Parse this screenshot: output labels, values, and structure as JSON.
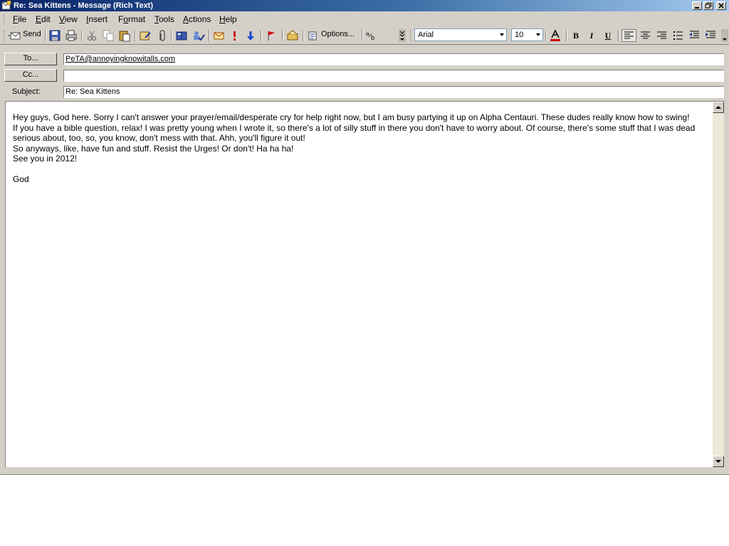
{
  "window": {
    "title": "Re: Sea Kittens - Message (Rich Text)"
  },
  "menu": [
    {
      "label": "File",
      "accel": "F",
      "rest": "ile"
    },
    {
      "label": "Edit",
      "accel": "E",
      "rest": "dit"
    },
    {
      "label": "View",
      "accel": "V",
      "rest": "iew"
    },
    {
      "label": "Insert",
      "accel": "I",
      "rest": "nsert"
    },
    {
      "label": "Format",
      "pre": "F",
      "accel": "o",
      "rest": "rmat"
    },
    {
      "label": "Tools",
      "accel": "T",
      "rest": "ools"
    },
    {
      "label": "Actions",
      "accel": "A",
      "rest": "ctions"
    },
    {
      "label": "Help",
      "accel": "H",
      "rest": "elp"
    }
  ],
  "toolbar": {
    "send_label": "Send",
    "options_label": "Options...",
    "font_name": "Arial",
    "font_size": "10",
    "bold": "B",
    "italic": "I",
    "underline": "U",
    "font_color": "#cc0000"
  },
  "header": {
    "to_button": "To...",
    "cc_button": "Cc...",
    "subject_label": "Subject:",
    "to_value": "PeTA@annoyingknowitalls.com",
    "cc_value": "",
    "subject_value": "Re: Sea Kittens"
  },
  "message": {
    "body": "Hey guys, God here. Sorry I can't answer your prayer/email/desperate cry for help right now, but I am busy partying it up on Alpha Centauri. These dudes really know how to swing!\nIf you have a bible question, relax! I was pretty young when I wrote it, so there's a lot of silly stuff in there you don't have to worry about. Of course, there's some stuff that I was dead serious about, too, so, you know, don't mess with that. Ahh, you'll figure it out!\nSo anyways, like, have fun and stuff. Resist the Urges! Or don't! Ha ha ha!\nSee you in 2012!\n\nGod"
  }
}
